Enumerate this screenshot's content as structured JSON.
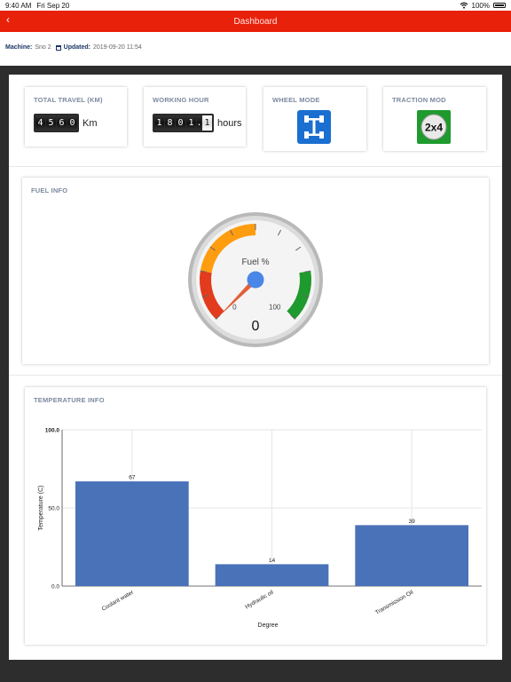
{
  "status_bar": {
    "time": "9:40 AM",
    "date": "Fri Sep 20",
    "battery": "100%"
  },
  "nav": {
    "back_label": "‹",
    "title": "Dashboard"
  },
  "info": {
    "machine_label": "Machine:",
    "machine_value": "Sno 2",
    "updated_label": "Updated:",
    "updated_value": "2019-09-20 11:54"
  },
  "cards": {
    "travel": {
      "label": "TOTAL TRAVEL (KM)",
      "digits": [
        "4",
        "5",
        "6",
        "0"
      ],
      "unit": "Km"
    },
    "hours": {
      "label": "WORKING HOUR",
      "digits": [
        "1",
        "8",
        "0",
        "1"
      ],
      "dot": ".",
      "fraction": "1",
      "unit": "hours"
    },
    "wheel": {
      "label": "WHEEL MODE",
      "icon": "wheel-mode-icon",
      "color": "#1a6fd0"
    },
    "traction": {
      "label": "TRACTION MOD",
      "icon_text": "2x4",
      "color": "#1f9a2e"
    }
  },
  "fuel": {
    "label": "FUEL INFO",
    "gauge_title": "Fuel %",
    "min_label": "0",
    "max_label": "100",
    "value": 0,
    "value_display": "0"
  },
  "temperature": {
    "label": "TEMPERATURE INFO"
  },
  "chart_data": {
    "type": "bar",
    "categories": [
      "Coolant water",
      "Hydraulic oil",
      "Transmission Oil"
    ],
    "values": [
      67,
      14,
      39
    ],
    "value_labels": [
      "67",
      "14",
      "39"
    ],
    "xlabel": "Degree",
    "ylabel": "Temperature (C)",
    "ylim": [
      0,
      100
    ],
    "y_ticks": [
      "0.0",
      "50.0",
      "100.0"
    ],
    "bar_color": "#4a72b8",
    "grid": true
  }
}
